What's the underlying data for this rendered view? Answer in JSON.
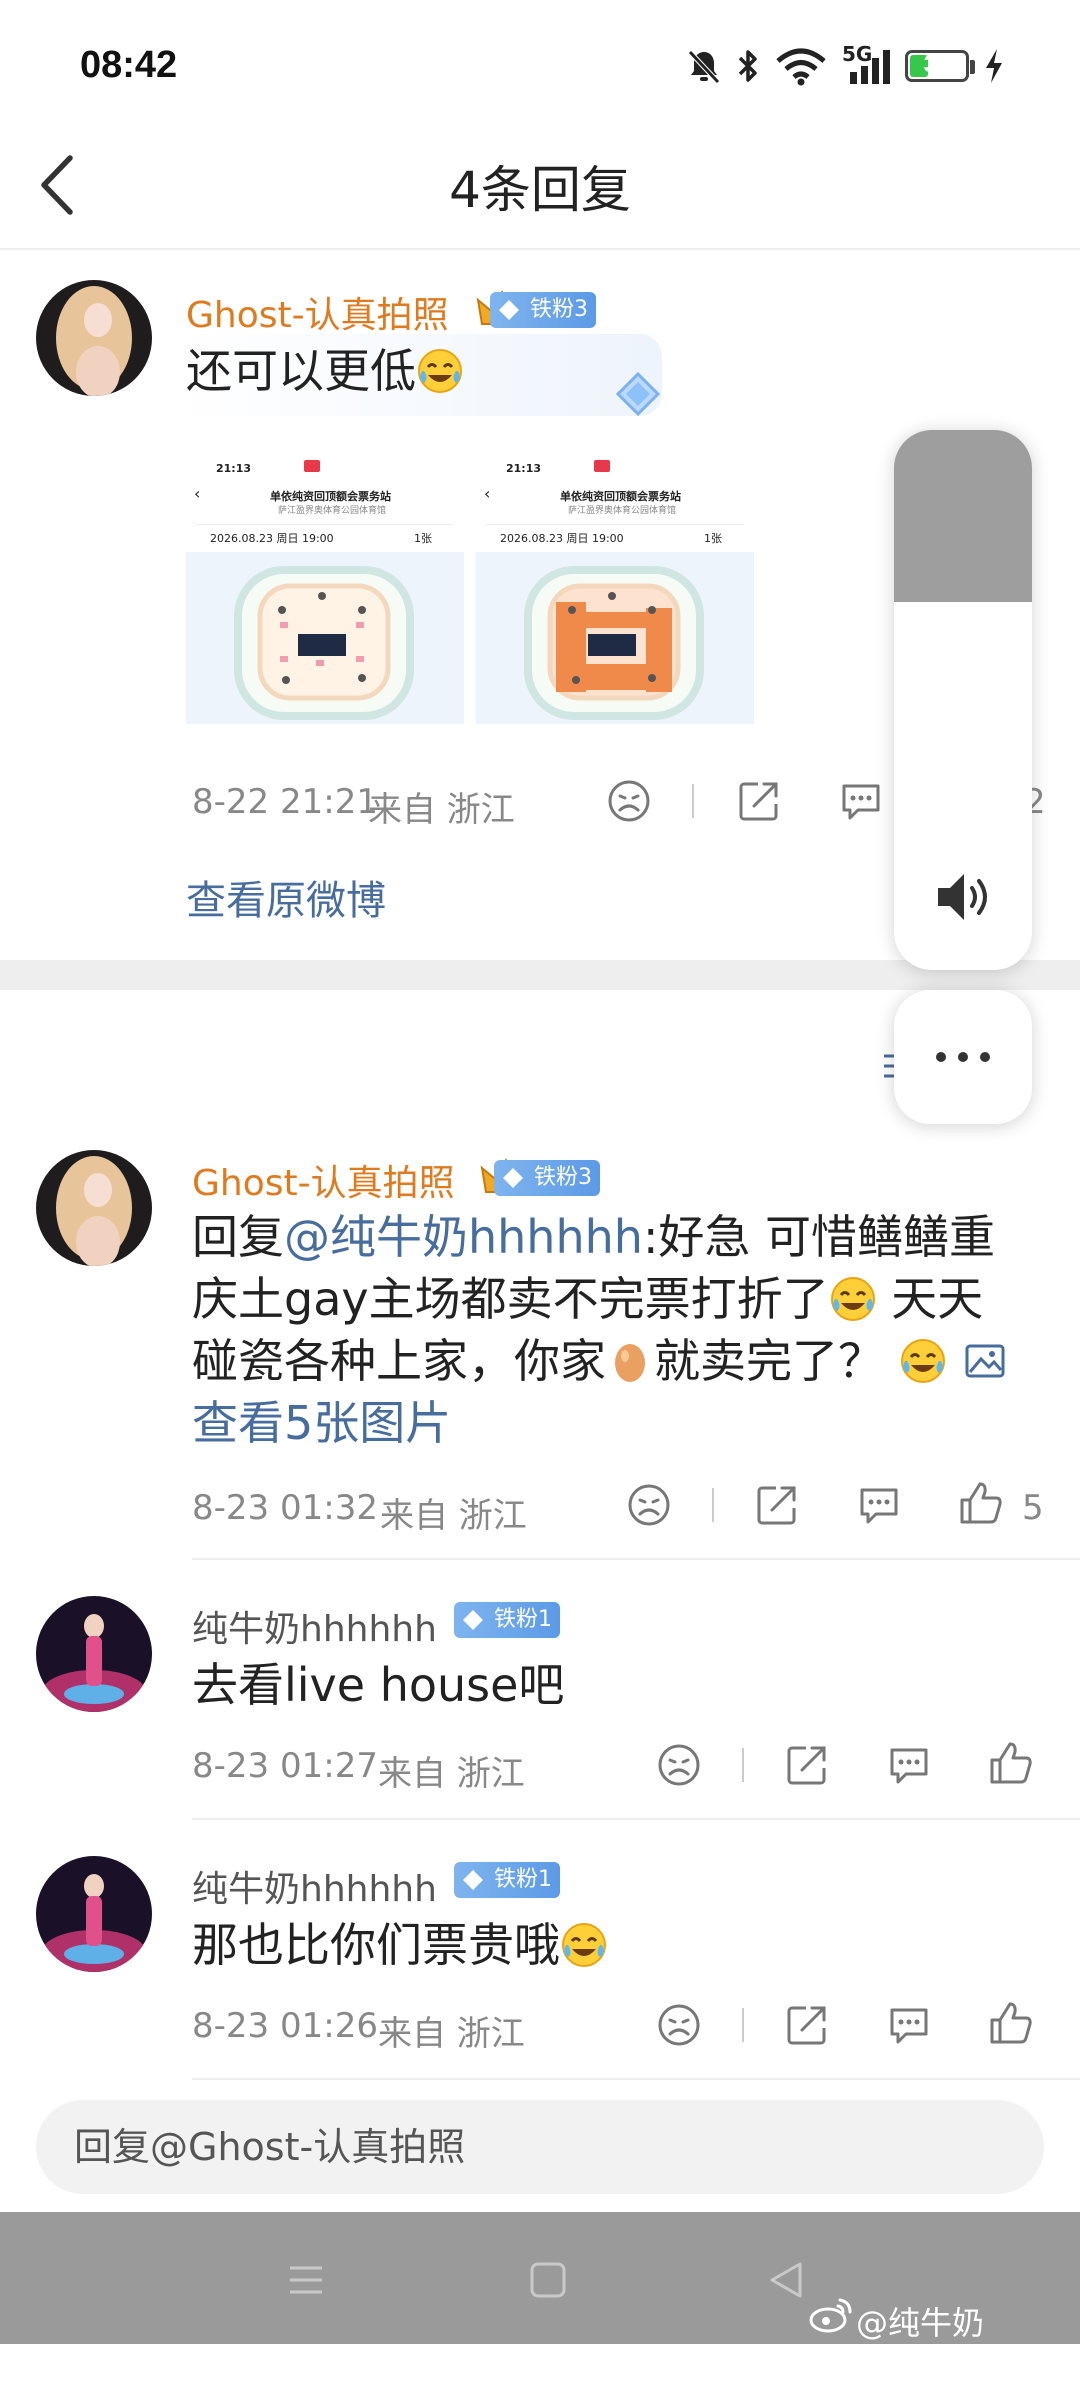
{
  "status_bar": {
    "time": "08:42",
    "network": "5G",
    "battery": "33",
    "battery_level": 0.33
  },
  "header": {
    "title": "4条回复"
  },
  "root_comment": {
    "username": "Ghost-认真拍照",
    "badge": "铁粉3",
    "text": "还可以更低",
    "images": [
      {
        "time": "21:13",
        "heading": "单依纯资回顶额会票务站",
        "sub": "萨江盈界奥体育公园体育馆",
        "date": "2026.08.23 周日 19:00",
        "qty": "1张"
      },
      {
        "time": "21:13",
        "heading": "单依纯资回顶额会票务站",
        "sub": "萨江盈界奥体育公园体育馆",
        "date": "2026.08.23 周日 19:00",
        "qty": "1张"
      }
    ],
    "timestamp": "8-22 21:21",
    "location": "来自 浙江",
    "like_count": "2",
    "view_original": "查看原微博"
  },
  "replies": [
    {
      "username": "Ghost-认真拍照",
      "badge": "铁粉3",
      "prefix": "回复",
      "mention": "@纯牛奶hhhhhh",
      "line1_rest": ":好急 可惜鳝鳝重",
      "line2": "庆土gay主场都卖不完票打折了",
      "line2_end": " 天天",
      "line3_a": "碰瓷各种上家，你家",
      "line3_b": "就卖完了？",
      "view_images": "查看5张图片",
      "timestamp": "8-23 01:32",
      "location": "来自 浙江",
      "like_count": "5"
    },
    {
      "username": "纯牛奶hhhhhh",
      "badge": "铁粉1",
      "text": "去看live house吧",
      "timestamp": "8-23 01:27",
      "location": "来自 浙江"
    },
    {
      "username": "纯牛奶hhhhhh",
      "badge": "铁粉1",
      "text": "那也比你们票贵哦",
      "timestamp": "8-23 01:26",
      "location": "来自 浙江"
    }
  ],
  "reply_box": {
    "placeholder": "回复@Ghost-认真拍照"
  },
  "volume": {
    "level": 0.42
  },
  "watermark": "@纯牛奶hhhhhh",
  "colors": {
    "orange_name": "#e07a1f",
    "link": "#476c9e",
    "badge_blue": "#6aa6ec",
    "battery_green": "#37c74b"
  }
}
